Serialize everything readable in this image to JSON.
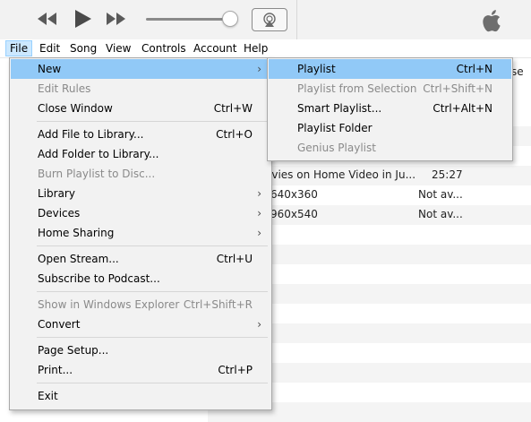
{
  "menubar": {
    "items": [
      {
        "label": "File"
      },
      {
        "label": "Edit"
      },
      {
        "label": "Song"
      },
      {
        "label": "View"
      },
      {
        "label": "Controls"
      },
      {
        "label": "Account"
      },
      {
        "label": "Help"
      }
    ]
  },
  "player": {
    "icons": [
      "rewind-icon",
      "play-icon",
      "fast-forward-icon",
      "airplay-icon",
      "apple-logo"
    ]
  },
  "content": {
    "header_fragment": "se",
    "rows": [
      {
        "name": "...",
        "time": "",
        "fragment_top": true
      },
      {
        "name": "ovies on Home Video in Ju...",
        "time": "25:27"
      },
      {
        "name": "640x360",
        "time": "Not av..."
      },
      {
        "name": "960x540",
        "time": "Not av..."
      }
    ]
  },
  "file_menu": {
    "items": {
      "new": {
        "label": "New"
      },
      "edit_rules": {
        "label": "Edit Rules"
      },
      "close_window": {
        "label": "Close Window",
        "shortcut": "Ctrl+W"
      },
      "add_file": {
        "label": "Add File to Library...",
        "shortcut": "Ctrl+O"
      },
      "add_folder": {
        "label": "Add Folder to Library..."
      },
      "burn_playlist": {
        "label": "Burn Playlist to Disc..."
      },
      "library": {
        "label": "Library"
      },
      "devices": {
        "label": "Devices"
      },
      "home_sharing": {
        "label": "Home Sharing"
      },
      "open_stream": {
        "label": "Open Stream...",
        "shortcut": "Ctrl+U"
      },
      "subscribe_podcast": {
        "label": "Subscribe to Podcast..."
      },
      "show_explorer": {
        "label": "Show in Windows Explorer",
        "shortcut": "Ctrl+Shift+R"
      },
      "convert": {
        "label": "Convert"
      },
      "page_setup": {
        "label": "Page Setup..."
      },
      "print": {
        "label": "Print...",
        "shortcut": "Ctrl+P"
      },
      "exit": {
        "label": "Exit"
      }
    },
    "arrow_glyph": "›"
  },
  "new_submenu": {
    "items": {
      "playlist": {
        "label": "Playlist",
        "shortcut": "Ctrl+N"
      },
      "playlist_from_selection": {
        "label": "Playlist from Selection",
        "shortcut": "Ctrl+Shift+N"
      },
      "smart_playlist": {
        "label": "Smart Playlist...",
        "shortcut": "Ctrl+Alt+N"
      },
      "playlist_folder": {
        "label": "Playlist Folder"
      },
      "genius_playlist": {
        "label": "Genius Playlist"
      }
    }
  },
  "colors": {
    "highlight": "#91c9f7",
    "menu_bg": "#f2f2f2",
    "disabled_text": "#8a8a8a"
  }
}
